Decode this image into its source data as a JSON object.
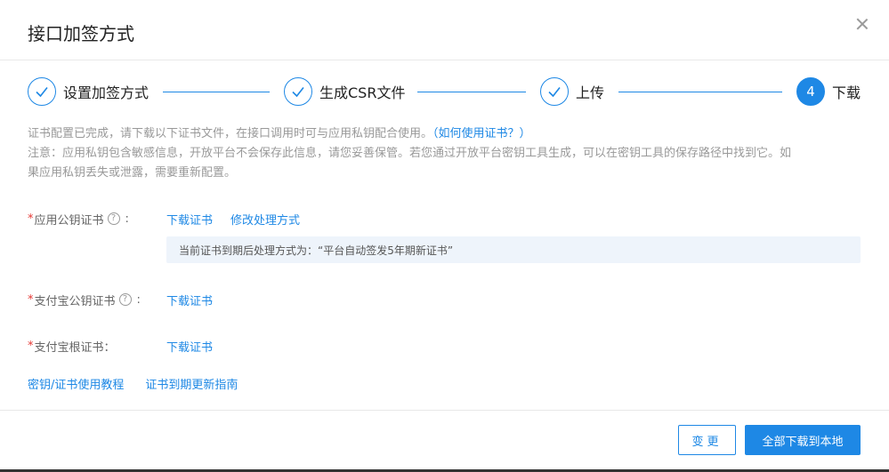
{
  "dialog": {
    "title": "接口加签方式"
  },
  "steps": [
    {
      "label": "设置加签方式",
      "state": "done"
    },
    {
      "label": "生成CSR文件",
      "state": "done"
    },
    {
      "label": "上传",
      "state": "done"
    },
    {
      "label": "下载",
      "state": "active",
      "number": "4"
    }
  ],
  "notes": {
    "line1": "证书配置已完成，请下载以下证书文件，在接口调用时可与应用私钥配合使用。",
    "line1_link": "（如何使用证书？）",
    "line2": "注意：应用私钥包含敏感信息，开放平台不会保存此信息，请您妥善保管。若您通过开放平台密钥工具生成，可以在密钥工具的保存路径中找到它。如",
    "line3": "果应用私钥丢失或泄露，需要重新配置。"
  },
  "cert_rows": {
    "app_cert": {
      "label": "应用公钥证书",
      "required_mark": "*",
      "help": "?",
      "colon": ":",
      "download": "下载证书",
      "modify": "修改处理方式",
      "info": "当前证书到期后处理方式为：“平台自动签发5年期新证书”"
    },
    "alipay_cert": {
      "label": "支付宝公钥证书",
      "required_mark": "*",
      "help": "?",
      "colon": ":",
      "download": "下载证书"
    },
    "alipay_root": {
      "label": "支付宝根证书：",
      "required_mark": "*",
      "download": "下载证书"
    }
  },
  "bottom_links": {
    "tutorial": "密钥/证书使用教程",
    "renew_guide": "证书到期更新指南"
  },
  "footer": {
    "change": "变更",
    "download_all": "全部下载到本地"
  },
  "colors": {
    "accent": "#1e88e5",
    "required": "#e53935",
    "info_bg": "#eef4fb"
  }
}
